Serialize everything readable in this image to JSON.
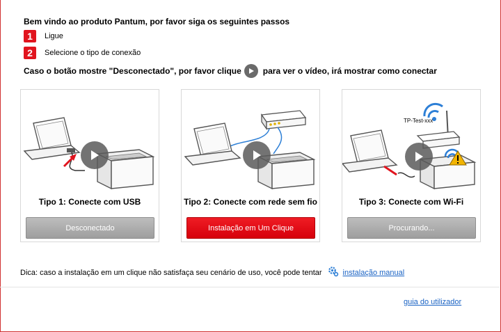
{
  "header": {
    "welcome": "Bem vindo ao produto Pantum, por favor siga os seguintes passos",
    "steps": [
      {
        "num": "1",
        "label": "Ligue"
      },
      {
        "num": "2",
        "label": "Selecione o tipo de conexão"
      }
    ],
    "hint_before": "Caso o botão mostre \"Desconectado\", por favor clique",
    "hint_after": "para ver o vídeo, irá mostrar como conectar"
  },
  "cards": [
    {
      "title": "Tipo 1: Conecte com USB",
      "button": "Desconectado",
      "button_state": "disabled"
    },
    {
      "title": "Tipo 2: Conecte com rede sem fio",
      "button": "Instalação em Um Clique",
      "button_state": "active"
    },
    {
      "title": "Tipo 3: Conecte com Wi-Fi",
      "button": "Procurando...",
      "button_state": "disabled",
      "ssid": "TP-Test-xxx"
    }
  ],
  "footer": {
    "tip": "Dica: caso a instalação em um clique não satisfaça seu cenário de uso, você pode tentar",
    "manual_link": "instalação manual",
    "guide_link": "guia do utilizador"
  },
  "colors": {
    "accent_red": "#e1141e",
    "link_blue": "#1a63c4",
    "wifi_blue": "#2d7fd6"
  }
}
